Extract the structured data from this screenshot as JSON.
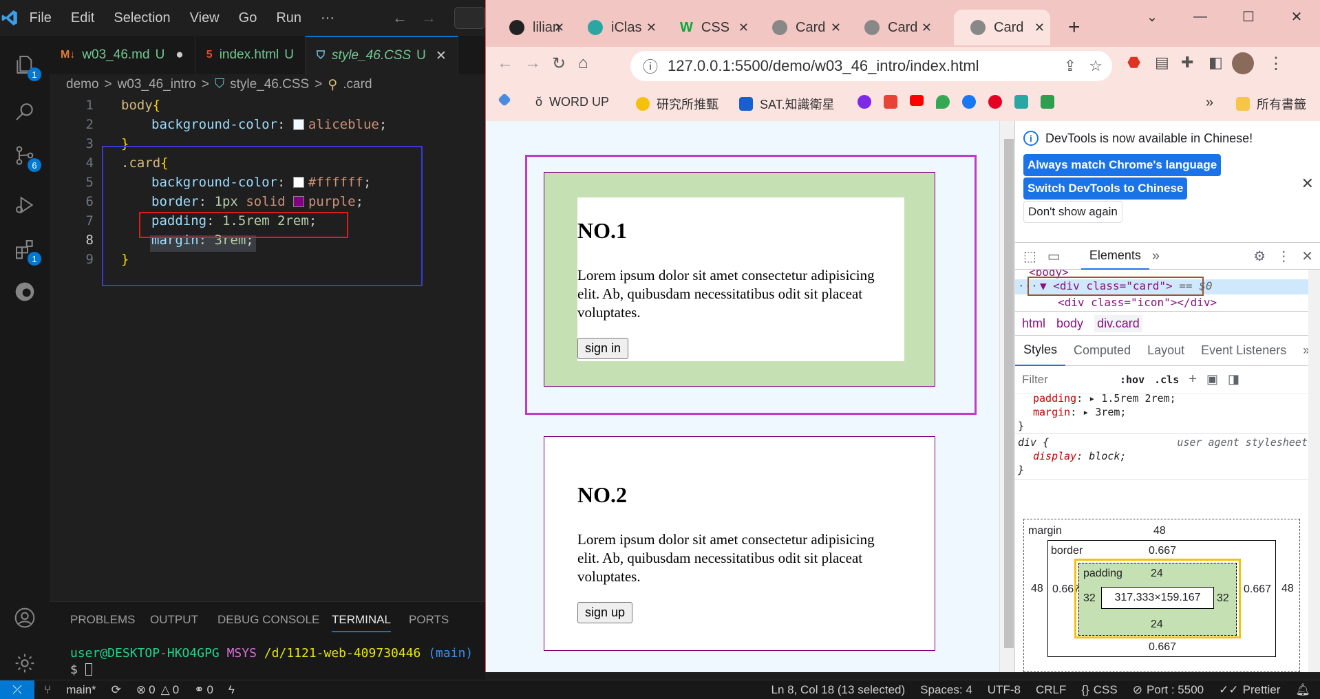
{
  "vscode": {
    "menu": [
      "File",
      "Edit",
      "Selection",
      "View",
      "Go",
      "Run",
      "···"
    ],
    "activity_badges": {
      "explorer": "1",
      "scm": "6",
      "extensions": "1"
    },
    "tabs": [
      {
        "label": "w03_46.md",
        "suffix": "U",
        "dirty": "●"
      },
      {
        "label": "index.html",
        "suffix": "U"
      },
      {
        "label": "style_46.CSS",
        "suffix": "U",
        "close": "✕"
      }
    ],
    "breadcrumb": [
      "demo",
      ">",
      "w03_46_intro",
      ">",
      "style_46.CSS",
      ">",
      ".card"
    ],
    "line_numbers": [
      "1",
      "2",
      "3",
      "4",
      "5",
      "6",
      "7",
      "8",
      "9"
    ],
    "code": {
      "l1_sel": "body",
      "l1_brace": "{",
      "l2_prop": "background-color",
      "l2_val": "aliceblue",
      "l3_brace": "}",
      "l4_sel": ".card",
      "l4_brace": "{",
      "l5_prop": "background-color",
      "l5_val": "#ffffff",
      "l6_prop": "border",
      "l6_val1": "1px",
      "l6_val2": "solid",
      "l6_val3": "purple",
      "l7_prop": "padding",
      "l7_val": "1.5rem 2rem",
      "l8_prop": "margin",
      "l8_val": "3rem",
      "l9_brace": "}"
    },
    "panel_tabs": [
      "PROBLEMS",
      "OUTPUT",
      "DEBUG CONSOLE",
      "TERMINAL",
      "PORTS"
    ],
    "terminal": {
      "user": "user@DESKTOP-HKO4GPG",
      "shell": "MSYS",
      "path": "/d/1121-web-409730446",
      "branch": "(main)",
      "prompt": "$"
    },
    "status": {
      "branch": "main*",
      "errors": "0",
      "warnings": "0",
      "ports_count": "0",
      "position": "Ln 8, Col 18 (13 selected)",
      "spaces": "Spaces: 4",
      "encoding": "UTF-8",
      "eol": "CRLF",
      "language": "CSS",
      "port": "Port : 5500",
      "prettier": "Prettier"
    }
  },
  "chrome": {
    "tabs": [
      "lilian",
      "iClas",
      "CSS",
      "Card",
      "Card",
      "Card"
    ],
    "new_tab": "+",
    "url": "127.0.0.1:5500/demo/w03_46_intro/index.html",
    "bookmarks": [
      "WORD UP",
      "研究所推甄",
      "SAT.知識衛星"
    ],
    "bookmarks_more": "»",
    "all_bookmarks": "所有書籤"
  },
  "page": {
    "card1": {
      "title": "NO.1",
      "text": "Lorem ipsum dolor sit amet consectetur adipisicing elit. Ab, quibusdam necessitatibus odit sit placeat voluptates.",
      "button": "sign in"
    },
    "card2": {
      "title": "NO.2",
      "text": "Lorem ipsum dolor sit amet consectetur adipisicing elit. Ab, quibusdam necessitatibus odit sit placeat voluptates.",
      "button": "sign up"
    }
  },
  "devtools": {
    "notice": "DevTools is now available in Chinese!",
    "btn_match": "Always match Chrome's language",
    "btn_switch": "Switch DevTools to Chinese",
    "btn_dont": "Don't show again",
    "panel_elements": "Elements",
    "dom_body": "<body>",
    "dom_selected": "<div class=\"card\">",
    "dom_eq": "== $0",
    "dom_child": "<div class=\"icon\"></div>",
    "crumbs": [
      "html",
      "body",
      "div.card"
    ],
    "style_tabs": [
      "Styles",
      "Computed",
      "Layout",
      "Event Listeners"
    ],
    "filter_placeholder": "Filter",
    "hov": ":hov",
    "cls": ".cls",
    "rules": {
      "padding_prop": "padding",
      "padding_val": "1.5rem 2rem;",
      "margin_prop": "margin",
      "margin_val": "3rem;",
      "div_sel": "div {",
      "ua": "user agent stylesheet",
      "display_prop": "display",
      "display_val": "block;"
    },
    "boxmodel": {
      "margin_label": "margin",
      "margin": "48",
      "border_label": "border",
      "border": "0.667",
      "padding_label": "padding",
      "padding_top": "24",
      "padding_side": "32",
      "padding_bottom": "24",
      "content": "317.333×159.167"
    }
  },
  "colors": {
    "accent": "#0078d4",
    "purple": "#800080",
    "card1_padding": "#c5e1b4"
  }
}
